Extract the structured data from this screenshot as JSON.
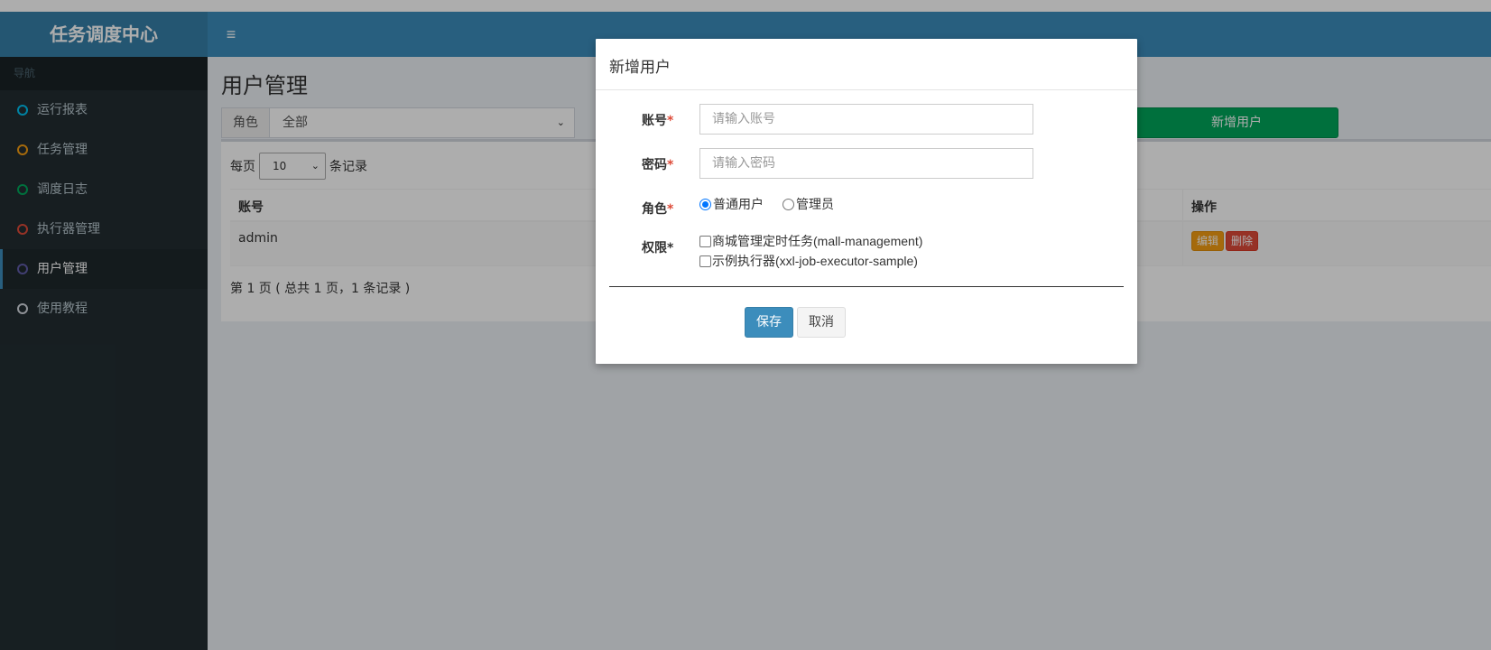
{
  "app": {
    "title": "任务调度中心"
  },
  "header": {
    "menu_toggle_glyph": "≡"
  },
  "sidebar": {
    "header": "导航",
    "items": [
      {
        "label": "运行报表",
        "color": "#00c0ef"
      },
      {
        "label": "任务管理",
        "color": "#f39c12"
      },
      {
        "label": "调度日志",
        "color": "#00a65a"
      },
      {
        "label": "执行器管理",
        "color": "#dd4b39"
      },
      {
        "label": "用户管理",
        "color": "#605ca8",
        "active": true
      },
      {
        "label": "使用教程",
        "color": "#d2d6de"
      }
    ]
  },
  "main": {
    "title": "用户管理",
    "filter": {
      "label": "角色",
      "value": "全部"
    },
    "add_user_label": "新增用户",
    "perpage": {
      "prefix": "每页",
      "value": "10",
      "suffix": "条记录"
    },
    "table": {
      "columns": [
        "账号",
        "操作"
      ],
      "rows": [
        {
          "account": "admin",
          "edit": "编辑",
          "delete": "删除"
        }
      ]
    },
    "page_info": "第 1 页 ( 总共 1 页，1 条记录 )"
  },
  "modal": {
    "title": "新增用户",
    "account": {
      "label": "账号",
      "required": "*",
      "placeholder": "请输入账号"
    },
    "password": {
      "label": "密码",
      "required": "*",
      "placeholder": "请输入密码"
    },
    "role": {
      "label": "角色",
      "required": "*",
      "options": [
        "普通用户",
        "管理员"
      ],
      "selected": "普通用户"
    },
    "permission": {
      "label": "权限*",
      "options": [
        "商城管理定时任务(mall-management)",
        "示例执行器(xxl-job-executor-sample)"
      ]
    },
    "save_label": "保存",
    "cancel_label": "取消"
  },
  "colors": {
    "brand": "#3c8dbc",
    "sidebar_bg": "#222d32",
    "success": "#00a65a",
    "warning": "#f39c12",
    "danger": "#dd4b39"
  }
}
